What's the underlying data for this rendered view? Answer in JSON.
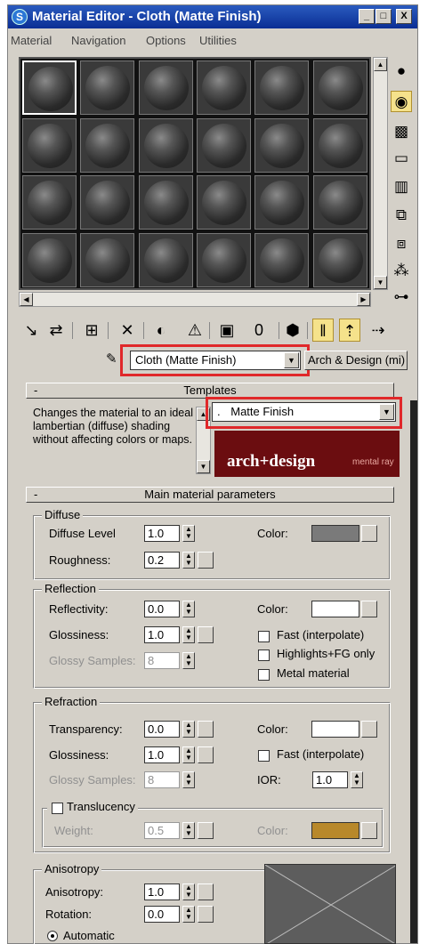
{
  "title_bar": {
    "title": "Material Editor - Cloth (Matte Finish)",
    "app_icon": "3ds-max-icon",
    "minimize_glyph": "_",
    "restore_glyph": "□",
    "close_glyph": "X"
  },
  "menu": [
    "Material",
    "Navigation",
    "Options",
    "Utilities"
  ],
  "sample_slots": {
    "rows": 4,
    "columns": 6,
    "selected_index": 0
  },
  "scroll_glyphs": {
    "up": "▲",
    "down": "▼",
    "left": "◀",
    "right": "▶"
  },
  "side_toolbar": [
    {
      "icon": "sample-type-sphere-icon",
      "glyph": "●",
      "active": false
    },
    {
      "icon": "backlight-icon",
      "glyph": "◉",
      "active": true
    },
    {
      "icon": "background-checker-icon",
      "glyph": "▩",
      "active": false
    },
    {
      "icon": "sample-uv-tiling-icon",
      "glyph": "▭",
      "active": false
    },
    {
      "icon": "video-color-check-icon",
      "glyph": "▥",
      "active": false
    },
    {
      "icon": "make-preview-icon",
      "glyph": "⧉",
      "active": false
    },
    {
      "icon": "options-icon",
      "glyph": "⧈",
      "active": false
    },
    {
      "icon": "select-by-material-icon",
      "glyph": "⁂",
      "active": false
    },
    {
      "icon": "material-map-navigator-icon",
      "glyph": "⊶",
      "active": false
    }
  ],
  "bottom_toolbar": [
    {
      "icon": "get-material-icon",
      "glyph": "↘"
    },
    {
      "icon": "put-material-to-scene-icon",
      "glyph": "⇄"
    },
    {
      "icon": "assign-material-to-selection-icon",
      "glyph": "⊞"
    },
    {
      "icon": "reset-map-icon",
      "glyph": "✕"
    },
    {
      "icon": "make-material-copy-icon",
      "glyph": "◐"
    },
    {
      "icon": "make-unique-icon",
      "glyph": "⚠"
    },
    {
      "icon": "put-to-library-icon",
      "glyph": "▣"
    },
    {
      "icon": "material-id-channel-icon",
      "glyph": "0"
    },
    {
      "icon": "show-standard-map-in-viewport-icon",
      "glyph": "⬢"
    },
    {
      "icon": "show-end-result-icon",
      "glyph": "ǁ"
    },
    {
      "icon": "go-to-parent-icon",
      "glyph": "⇡"
    },
    {
      "icon": "go-forward-to-sibling-icon",
      "glyph": "⇢"
    }
  ],
  "pick_icon_glyph": "✎",
  "material_name": "Cloth (Matte Finish)",
  "material_type": "Arch & Design (mi)",
  "templates": {
    "header": "Templates",
    "collapse": "-",
    "description": "Changes the material to an ideal lambertian (diffuse) shading without affecting colors or maps.",
    "template_value": "Matte Finish",
    "template_prefix": ".",
    "banner_brand": "arch+design",
    "banner_sub": "mental ray"
  },
  "main_params": {
    "header": "Main material parameters",
    "collapse": "-",
    "diffuse": {
      "title": "Diffuse",
      "diffuse_level_label": "Diffuse Level",
      "diffuse_level": "1.0",
      "roughness_label": "Roughness:",
      "roughness": "0.2",
      "color_label": "Color:",
      "color": "#7a7a7a"
    },
    "reflection": {
      "title": "Reflection",
      "reflectivity_label": "Reflectivity:",
      "reflectivity": "0.0",
      "glossiness_label": "Glossiness:",
      "glossiness": "1.0",
      "glossy_samples_label": "Glossy Samples:",
      "glossy_samples": "8",
      "color_label": "Color:",
      "color": "#ffffff",
      "fast_label": "Fast (interpolate)",
      "highlights_label": "Highlights+FG only",
      "metal_label": "Metal material"
    },
    "refraction": {
      "title": "Refraction",
      "transparency_label": "Transparency:",
      "transparency": "0.0",
      "glossiness_label": "Glossiness:",
      "glossiness": "1.0",
      "glossy_samples_label": "Glossy Samples:",
      "glossy_samples": "8",
      "color_label": "Color:",
      "color": "#ffffff",
      "fast_label": "Fast (interpolate)",
      "ior_label": "IOR:",
      "ior": "1.0"
    },
    "translucency": {
      "title": "Translucency",
      "weight_label": "Weight:",
      "weight": "0.5",
      "color_label": "Color:",
      "color": "#b8882a"
    },
    "anisotropy": {
      "title": "Anisotropy",
      "anisotropy_label": "Anisotropy:",
      "anisotropy": "1.0",
      "rotation_label": "Rotation:",
      "rotation": "0.0",
      "automatic_label": "Automatic"
    }
  }
}
